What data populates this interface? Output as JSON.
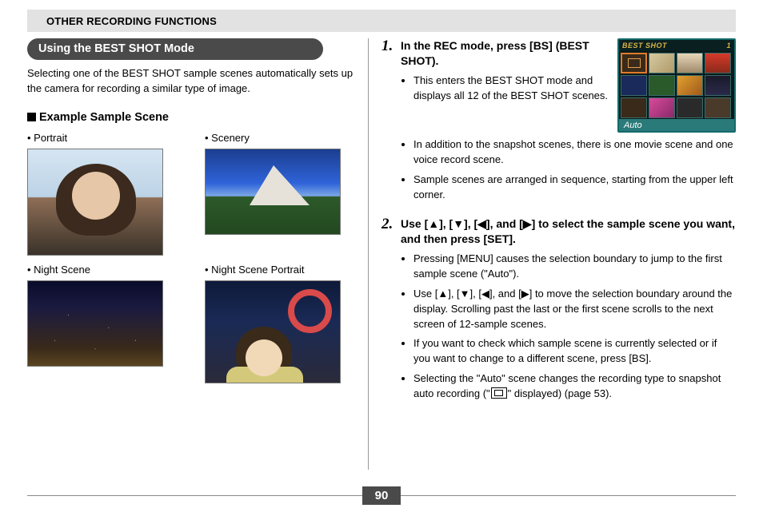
{
  "header": {
    "title": "OTHER RECORDING FUNCTIONS"
  },
  "left": {
    "section_title": "Using the BEST SHOT Mode",
    "intro": "Selecting one of the BEST SHOT sample scenes automatically sets up the camera for recording a similar type of image.",
    "sub_heading": "Example Sample Scene",
    "samples": {
      "portrait": "• Portrait",
      "scenery": "• Scenery",
      "night": "• Night Scene",
      "night_portrait": "• Night Scene Portrait"
    }
  },
  "right": {
    "screen": {
      "title": "BEST SHOT",
      "index": "1",
      "mode": "Auto"
    },
    "step1": {
      "num": "1.",
      "head": "In the REC mode, press [BS] (BEST SHOT).",
      "bullets": [
        "This enters the BEST SHOT mode and displays all 12 of the BEST SHOT scenes.",
        "In addition to the snapshot scenes, there is one movie scene and one voice record scene.",
        "Sample scenes are arranged in sequence, starting from the upper left corner."
      ]
    },
    "step2": {
      "num": "2.",
      "head": "Use [▲], [▼], [◀], and [▶] to select the sample scene you want, and then press [SET].",
      "bullets_a": "Pressing [MENU] causes the selection boundary to jump to the first sample scene (\"Auto\").",
      "bullets_b": "Use [▲], [▼], [◀], and [▶] to move the selection boundary around the display. Scrolling past the last or the first scene scrolls to the next screen of 12-sample scenes.",
      "bullets_c": "If you want to check which sample scene is currently selected or if you want to change to a different scene, press [BS].",
      "bullets_d_pre": "Selecting the \"Auto\" scene changes the recording type to snapshot auto recording (\"",
      "bullets_d_post": "\" displayed) (page 53)."
    }
  },
  "page_number": "90"
}
